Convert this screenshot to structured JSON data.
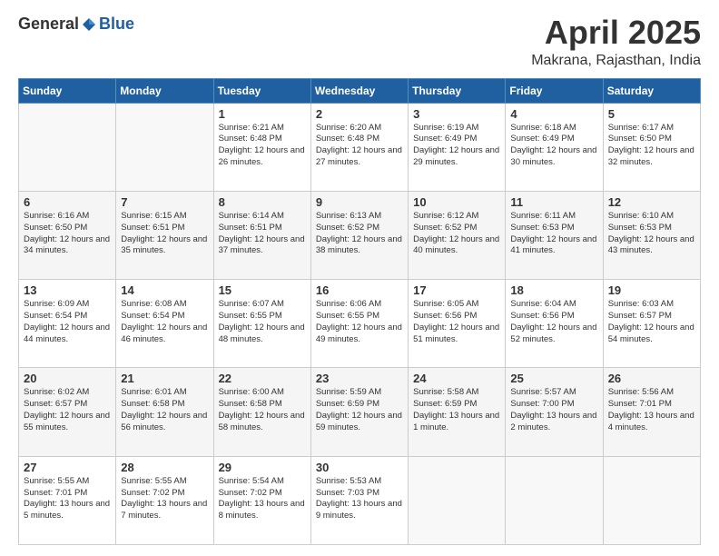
{
  "header": {
    "logo_general": "General",
    "logo_blue": "Blue",
    "month": "April 2025",
    "location": "Makrana, Rajasthan, India"
  },
  "columns": [
    "Sunday",
    "Monday",
    "Tuesday",
    "Wednesday",
    "Thursday",
    "Friday",
    "Saturday"
  ],
  "weeks": [
    [
      {
        "day": "",
        "info": ""
      },
      {
        "day": "",
        "info": ""
      },
      {
        "day": "1",
        "info": "Sunrise: 6:21 AM\nSunset: 6:48 PM\nDaylight: 12 hours and 26 minutes."
      },
      {
        "day": "2",
        "info": "Sunrise: 6:20 AM\nSunset: 6:48 PM\nDaylight: 12 hours and 27 minutes."
      },
      {
        "day": "3",
        "info": "Sunrise: 6:19 AM\nSunset: 6:49 PM\nDaylight: 12 hours and 29 minutes."
      },
      {
        "day": "4",
        "info": "Sunrise: 6:18 AM\nSunset: 6:49 PM\nDaylight: 12 hours and 30 minutes."
      },
      {
        "day": "5",
        "info": "Sunrise: 6:17 AM\nSunset: 6:50 PM\nDaylight: 12 hours and 32 minutes."
      }
    ],
    [
      {
        "day": "6",
        "info": "Sunrise: 6:16 AM\nSunset: 6:50 PM\nDaylight: 12 hours and 34 minutes."
      },
      {
        "day": "7",
        "info": "Sunrise: 6:15 AM\nSunset: 6:51 PM\nDaylight: 12 hours and 35 minutes."
      },
      {
        "day": "8",
        "info": "Sunrise: 6:14 AM\nSunset: 6:51 PM\nDaylight: 12 hours and 37 minutes."
      },
      {
        "day": "9",
        "info": "Sunrise: 6:13 AM\nSunset: 6:52 PM\nDaylight: 12 hours and 38 minutes."
      },
      {
        "day": "10",
        "info": "Sunrise: 6:12 AM\nSunset: 6:52 PM\nDaylight: 12 hours and 40 minutes."
      },
      {
        "day": "11",
        "info": "Sunrise: 6:11 AM\nSunset: 6:53 PM\nDaylight: 12 hours and 41 minutes."
      },
      {
        "day": "12",
        "info": "Sunrise: 6:10 AM\nSunset: 6:53 PM\nDaylight: 12 hours and 43 minutes."
      }
    ],
    [
      {
        "day": "13",
        "info": "Sunrise: 6:09 AM\nSunset: 6:54 PM\nDaylight: 12 hours and 44 minutes."
      },
      {
        "day": "14",
        "info": "Sunrise: 6:08 AM\nSunset: 6:54 PM\nDaylight: 12 hours and 46 minutes."
      },
      {
        "day": "15",
        "info": "Sunrise: 6:07 AM\nSunset: 6:55 PM\nDaylight: 12 hours and 48 minutes."
      },
      {
        "day": "16",
        "info": "Sunrise: 6:06 AM\nSunset: 6:55 PM\nDaylight: 12 hours and 49 minutes."
      },
      {
        "day": "17",
        "info": "Sunrise: 6:05 AM\nSunset: 6:56 PM\nDaylight: 12 hours and 51 minutes."
      },
      {
        "day": "18",
        "info": "Sunrise: 6:04 AM\nSunset: 6:56 PM\nDaylight: 12 hours and 52 minutes."
      },
      {
        "day": "19",
        "info": "Sunrise: 6:03 AM\nSunset: 6:57 PM\nDaylight: 12 hours and 54 minutes."
      }
    ],
    [
      {
        "day": "20",
        "info": "Sunrise: 6:02 AM\nSunset: 6:57 PM\nDaylight: 12 hours and 55 minutes."
      },
      {
        "day": "21",
        "info": "Sunrise: 6:01 AM\nSunset: 6:58 PM\nDaylight: 12 hours and 56 minutes."
      },
      {
        "day": "22",
        "info": "Sunrise: 6:00 AM\nSunset: 6:58 PM\nDaylight: 12 hours and 58 minutes."
      },
      {
        "day": "23",
        "info": "Sunrise: 5:59 AM\nSunset: 6:59 PM\nDaylight: 12 hours and 59 minutes."
      },
      {
        "day": "24",
        "info": "Sunrise: 5:58 AM\nSunset: 6:59 PM\nDaylight: 13 hours and 1 minute."
      },
      {
        "day": "25",
        "info": "Sunrise: 5:57 AM\nSunset: 7:00 PM\nDaylight: 13 hours and 2 minutes."
      },
      {
        "day": "26",
        "info": "Sunrise: 5:56 AM\nSunset: 7:01 PM\nDaylight: 13 hours and 4 minutes."
      }
    ],
    [
      {
        "day": "27",
        "info": "Sunrise: 5:55 AM\nSunset: 7:01 PM\nDaylight: 13 hours and 5 minutes."
      },
      {
        "day": "28",
        "info": "Sunrise: 5:55 AM\nSunset: 7:02 PM\nDaylight: 13 hours and 7 minutes."
      },
      {
        "day": "29",
        "info": "Sunrise: 5:54 AM\nSunset: 7:02 PM\nDaylight: 13 hours and 8 minutes."
      },
      {
        "day": "30",
        "info": "Sunrise: 5:53 AM\nSunset: 7:03 PM\nDaylight: 13 hours and 9 minutes."
      },
      {
        "day": "",
        "info": ""
      },
      {
        "day": "",
        "info": ""
      },
      {
        "day": "",
        "info": ""
      }
    ]
  ]
}
